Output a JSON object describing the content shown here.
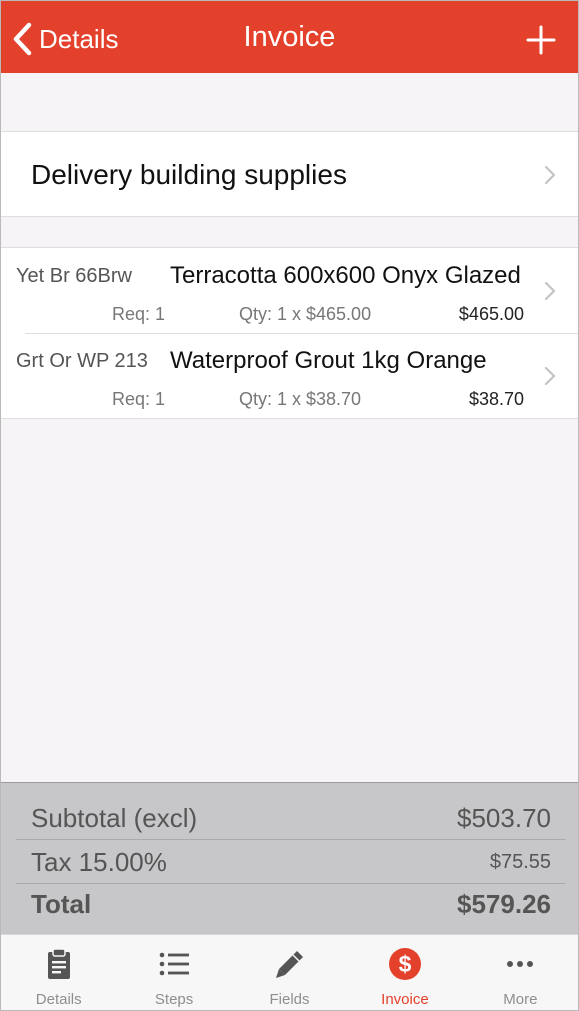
{
  "navbar": {
    "back_label": "Details",
    "title": "Invoice"
  },
  "description": "Delivery building supplies",
  "items": [
    {
      "code": "Yet Br 66Brw",
      "name": "Terracotta 600x600 Onyx Glazed",
      "req": "Req: 1",
      "qty": "Qty: 1 x $465.00",
      "total": "$465.00"
    },
    {
      "code": "Grt Or WP 213",
      "name": "Waterproof Grout 1kg Orange",
      "req": "Req: 1",
      "qty": "Qty: 1 x $38.70",
      "total": "$38.70"
    }
  ],
  "totals": {
    "subtotal_label": "Subtotal (excl)",
    "subtotal_value": "$503.70",
    "tax_label": "Tax 15.00%",
    "tax_value": "$75.55",
    "total_label": "Total",
    "total_value": "$579.26"
  },
  "tabs": [
    {
      "label": "Details",
      "icon": "clipboard-icon"
    },
    {
      "label": "Steps",
      "icon": "list-icon"
    },
    {
      "label": "Fields",
      "icon": "pencil-icon"
    },
    {
      "label": "Invoice",
      "icon": "dollar-icon"
    },
    {
      "label": "More",
      "icon": "more-icon"
    }
  ],
  "colors": {
    "accent": "#e4412c",
    "tab_inactive": "#555555"
  }
}
